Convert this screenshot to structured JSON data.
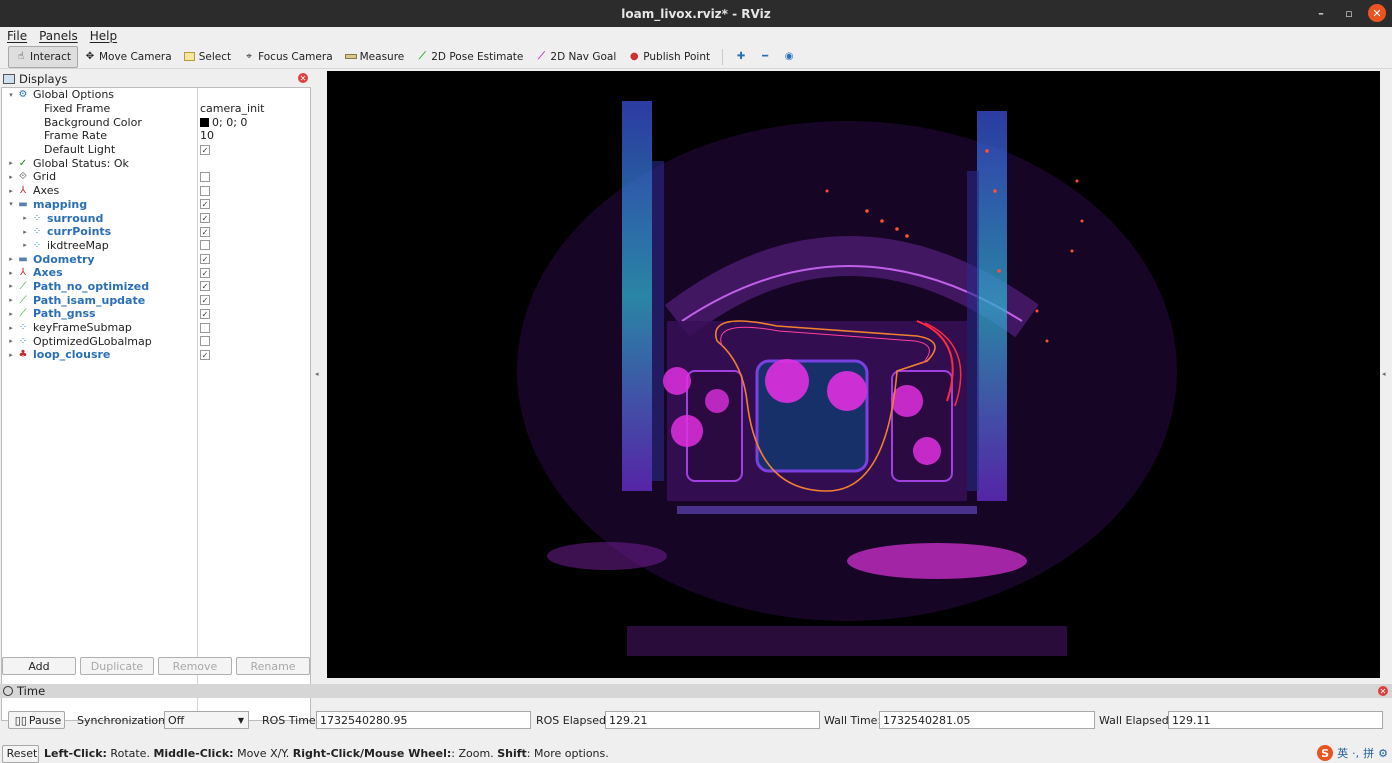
{
  "window": {
    "title": "loam_livox.rviz* - RViz"
  },
  "menu": [
    "File",
    "Panels",
    "Help"
  ],
  "toolbar": {
    "interact": "Interact",
    "move_camera": "Move Camera",
    "select": "Select",
    "focus_camera": "Focus Camera",
    "measure": "Measure",
    "pose_estimate": "2D Pose Estimate",
    "nav_goal": "2D Nav Goal",
    "publish_point": "Publish Point"
  },
  "displays": {
    "title": "Displays",
    "rows": [
      {
        "label": "Global Options",
        "value": "",
        "check": "",
        "level": 0,
        "arrow": "▾",
        "icon": "gear-icon",
        "bold": false
      },
      {
        "label": "Fixed Frame",
        "value": "camera_init",
        "check": "",
        "level": 1,
        "arrow": "",
        "icon": "",
        "bold": false
      },
      {
        "label": "Background Color",
        "value": "0; 0; 0",
        "check": "",
        "level": 1,
        "arrow": "",
        "icon": "",
        "bold": false,
        "swatch": "#000000"
      },
      {
        "label": "Frame Rate",
        "value": "10",
        "check": "",
        "level": 1,
        "arrow": "",
        "icon": "",
        "bold": false
      },
      {
        "label": "Default Light",
        "value": "",
        "check": "on",
        "level": 1,
        "arrow": "",
        "icon": "",
        "bold": false
      },
      {
        "label": "Global Status: Ok",
        "value": "",
        "check": "",
        "level": 0,
        "arrow": "▸",
        "icon": "check-icon",
        "bold": false
      },
      {
        "label": "Grid",
        "value": "",
        "check": "off",
        "level": 0,
        "arrow": "▸",
        "icon": "grid-icon",
        "bold": false
      },
      {
        "label": "Axes",
        "value": "",
        "check": "off",
        "level": 0,
        "arrow": "▸",
        "icon": "axes-icon",
        "bold": false
      },
      {
        "label": "mapping",
        "value": "",
        "check": "on",
        "level": 0,
        "arrow": "▾",
        "icon": "folder-icon",
        "bold": true
      },
      {
        "label": "surround",
        "value": "",
        "check": "on",
        "level": 1,
        "arrow": "▸",
        "icon": "pointcloud-icon",
        "bold": true
      },
      {
        "label": "currPoints",
        "value": "",
        "check": "on",
        "level": 1,
        "arrow": "▸",
        "icon": "pointcloud-icon",
        "bold": true
      },
      {
        "label": "ikdtreeMap",
        "value": "",
        "check": "off",
        "level": 1,
        "arrow": "▸",
        "icon": "pointcloud-icon",
        "bold": false
      },
      {
        "label": "Odometry",
        "value": "",
        "check": "on",
        "level": 0,
        "arrow": "▸",
        "icon": "folder-icon",
        "bold": true
      },
      {
        "label": "Axes",
        "value": "",
        "check": "on",
        "level": 0,
        "arrow": "▸",
        "icon": "axes-icon",
        "bold": true
      },
      {
        "label": "Path_no_optimized",
        "value": "",
        "check": "on",
        "level": 0,
        "arrow": "▸",
        "icon": "path-icon",
        "bold": true
      },
      {
        "label": "Path_isam_update",
        "value": "",
        "check": "on",
        "level": 0,
        "arrow": "▸",
        "icon": "path-icon",
        "bold": true
      },
      {
        "label": "Path_gnss",
        "value": "",
        "check": "on",
        "level": 0,
        "arrow": "▸",
        "icon": "path-icon",
        "bold": true
      },
      {
        "label": "keyFrameSubmap",
        "value": "",
        "check": "off",
        "level": 0,
        "arrow": "▸",
        "icon": "pointcloud-icon",
        "bold": false
      },
      {
        "label": "OptimizedGLobalmap",
        "value": "",
        "check": "off",
        "level": 0,
        "arrow": "▸",
        "icon": "pointcloud-icon",
        "bold": false
      },
      {
        "label": "loop_clousre",
        "value": "",
        "check": "on",
        "level": 0,
        "arrow": "▸",
        "icon": "marker-icon",
        "bold": true
      }
    ],
    "buttons": {
      "add": "Add",
      "duplicate": "Duplicate",
      "remove": "Remove",
      "rename": "Rename"
    }
  },
  "time": {
    "title": "Time",
    "pause": "Pause",
    "sync_label": "Synchronization:",
    "sync_value": "Off",
    "ros_time_label": "ROS Time:",
    "ros_time": "1732540280.95",
    "ros_elapsed_label": "ROS Elapsed:",
    "ros_elapsed": "129.21",
    "wall_time_label": "Wall Time:",
    "wall_time": "1732540281.05",
    "wall_elapsed_label": "Wall Elapsed:",
    "wall_elapsed": "129.11"
  },
  "status": {
    "reset": "Reset",
    "left_click": "Left-Click:",
    "left_click_desc": " Rotate. ",
    "middle_click": "Middle-Click:",
    "middle_click_desc": " Move X/Y. ",
    "right_click": "Right-Click/Mouse Wheel:",
    "right_click_desc": ": Zoom. ",
    "shift": "Shift",
    "shift_desc": ": More options."
  },
  "tray": {
    "lang": "英",
    "punct": "·,",
    "pinyin": "拼"
  }
}
